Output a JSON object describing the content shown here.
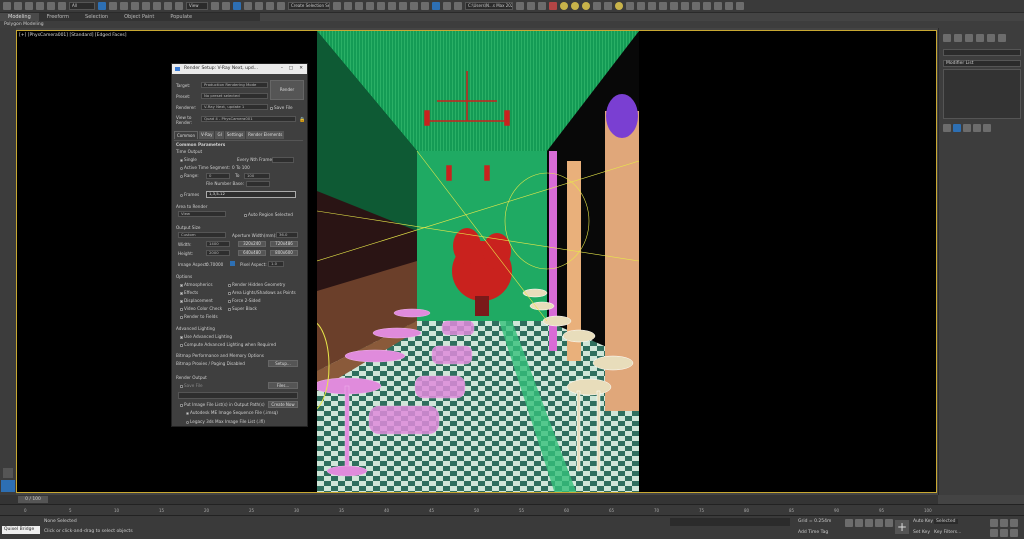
{
  "toolbar": {
    "view_dropdown": "All",
    "view_dropdown2": "View",
    "selection_set": "Create Selection Se",
    "path": "C:\\Users\\N...s Max 2020"
  },
  "ribbon": {
    "tabs": [
      "Modeling",
      "Freeform",
      "Selection",
      "Object Paint",
      "Populate"
    ],
    "subtab": "Polygon Modeling"
  },
  "viewport": {
    "label": "[+] [PhysCamera001] [Standard] [Edged Faces]"
  },
  "right_panel": {
    "modifier_list": "Modifier List"
  },
  "dialog": {
    "title": "Render Setup: V-Ray Next, upd...",
    "target_label": "Target:",
    "target_value": "Production Rendering Mode",
    "preset_label": "Preset:",
    "preset_value": "No preset selected",
    "renderer_label": "Renderer:",
    "renderer_value": "V-Ray Next, update 1",
    "save_file": "Save File",
    "render_button": "Render",
    "view_label": "View to Render:",
    "view_value": "Quad 4 - PhysCamera001",
    "tabs": [
      "Common",
      "V-Ray",
      "GI",
      "Settings",
      "Render Elements"
    ],
    "common_params": "Common Parameters",
    "time_output": "Time Output",
    "single": "Single",
    "every_nth": "Every Nth Frame:",
    "active_segment": "Active Time Segment:",
    "active_segment_value": "0 To 100",
    "range": "Range:",
    "range_from": "0",
    "range_to_label": "To",
    "range_to": "100",
    "file_number_base": "File Number Base:",
    "frames_label": "Frames",
    "frames_value": "1,3,5-12",
    "area_to_render": "Area to Render",
    "area_value": "View",
    "auto_region": "Auto Region Selected",
    "output_size": "Output Size",
    "output_size_value": "Custom",
    "aperture": "Aperture Width(mm):",
    "aperture_value": "36.0",
    "width_label": "Width:",
    "width_value": "1400",
    "height_label": "Height:",
    "height_value": "2000",
    "presets": [
      "320x240",
      "720x486",
      "640x480",
      "800x600"
    ],
    "image_aspect": "Image Aspect:",
    "image_aspect_value": "0.70000",
    "pixel_aspect": "Pixel Aspect:",
    "pixel_aspect_value": "1.0",
    "options": "Options",
    "options_left": [
      "Atmospherics",
      "Effects",
      "Displacement",
      "Video Color Check",
      "Render to Fields"
    ],
    "options_right": [
      "Render Hidden Geometry",
      "Area Lights/Shadows as Points",
      "Force 2-Sided",
      "Super Black"
    ],
    "advanced_lighting": "Advanced Lighting",
    "use_advanced": "Use Advanced Lighting",
    "compute_advanced": "Compute Advanced Lighting when Required",
    "bitmap_perf": "Bitmap Performance and Memory Options",
    "bitmap_proxies": "Bitmap Proxies / Paging Disabled",
    "setup_button": "Setup...",
    "render_output": "Render Output",
    "save_file_check": "Save File",
    "files_button": "Files...",
    "put_image": "Put Image File List(s) in Output Path(s)",
    "create_now": "Create Now",
    "autodesk_me": "Autodesk ME Image Sequence File (.imsq)",
    "legacy": "Legacy 3ds Max Image File List (.ifl)"
  },
  "timeline": {
    "frame_counter": "0 / 100",
    "ticks": [
      "0",
      "5",
      "10",
      "15",
      "20",
      "25",
      "30",
      "35",
      "40",
      "45",
      "50",
      "55",
      "60",
      "65",
      "70",
      "75",
      "80",
      "85",
      "90",
      "95",
      "100"
    ]
  },
  "status": {
    "script": "Quixel Bridge",
    "none_selected": "None Selected",
    "hint": "Click or click-and-drag to select objects",
    "grid": "Grid = 0.254m",
    "add_time_tag": "Add Time Tag",
    "auto_key": "Auto Key",
    "selected": "Selected",
    "set_key": "Set Key",
    "key_filters": "Key Filters..."
  },
  "colors": {
    "viewport_border": "#c8a832",
    "wall_green": "#1faa63",
    "ceiling_green": "#22b866",
    "plant_red": "#c9221e",
    "furniture_pink": "#e08bdc",
    "stool_cream": "#e8ddbb",
    "wall_orange": "#e0a77a",
    "floor_teal": "#2f6f5e"
  }
}
